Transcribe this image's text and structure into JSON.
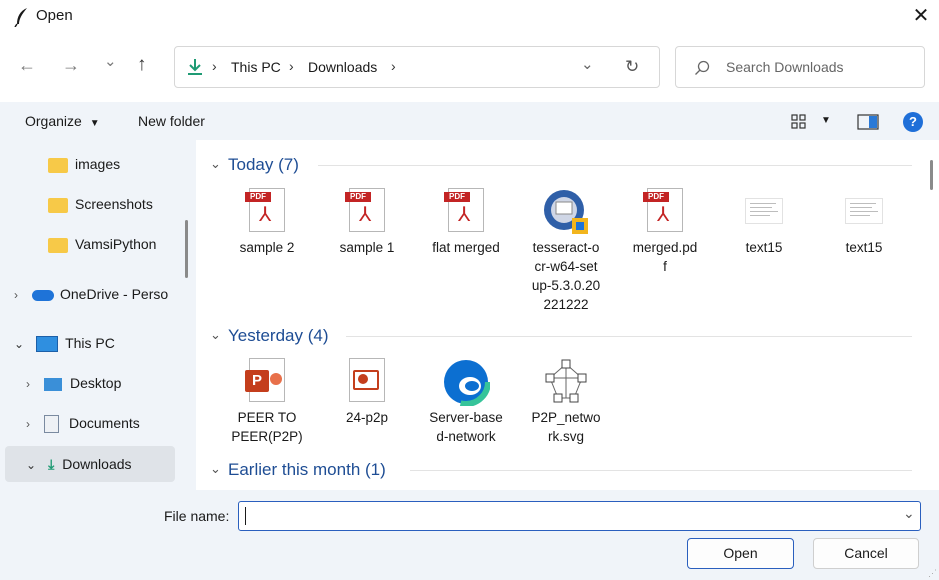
{
  "window": {
    "title": "Open",
    "close_glyph": "✕"
  },
  "nav": {
    "back_glyph": "←",
    "forward_glyph": "→",
    "recent_glyph": "⌄",
    "up_glyph": "↑",
    "breadcrumb": [
      "This PC",
      "Downloads"
    ],
    "refresh_glyph": "↻",
    "dropdown_glyph": "⌄",
    "search_placeholder": "Search Downloads"
  },
  "cmdbar": {
    "organize": "Organize",
    "new_folder": "New folder",
    "help_glyph": "?"
  },
  "sidebar": {
    "items": [
      {
        "label": "images",
        "icon": "folder-icon"
      },
      {
        "label": "Screenshots",
        "icon": "folder-icon"
      },
      {
        "label": "VamsiPython",
        "icon": "folder-icon"
      },
      {
        "label": "OneDrive - Perso",
        "icon": "onedrive-icon"
      },
      {
        "label": "This PC",
        "icon": "pc-icon"
      },
      {
        "label": "Desktop",
        "icon": "desktop-icon"
      },
      {
        "label": "Documents",
        "icon": "documents-icon"
      },
      {
        "label": "Downloads",
        "icon": "downloads-icon",
        "selected": true
      }
    ]
  },
  "groups": [
    {
      "label": "Today (7)"
    },
    {
      "label": "Yesterday (4)"
    },
    {
      "label": "Earlier this month (1)"
    }
  ],
  "today_files": [
    {
      "lines": [
        "sample 2"
      ],
      "icon": "pdf-icon"
    },
    {
      "lines": [
        "sample 1"
      ],
      "icon": "pdf-icon"
    },
    {
      "lines": [
        "flat merged"
      ],
      "icon": "pdf-icon"
    },
    {
      "lines": [
        "tesseract-o",
        "cr-w64-set",
        "up-5.3.0.20",
        "221222"
      ],
      "icon": "installer-icon"
    },
    {
      "lines": [
        "merged.pd",
        "f"
      ],
      "icon": "pdf-icon"
    },
    {
      "lines": [
        "text15"
      ],
      "icon": "text-file-icon"
    },
    {
      "lines": [
        "text15"
      ],
      "icon": "text-file-icon"
    }
  ],
  "yesterday_files": [
    {
      "lines": [
        "PEER TO",
        "PEER(P2P)"
      ],
      "icon": "powerpoint-icon"
    },
    {
      "lines": [
        "24-p2p"
      ],
      "icon": "powerpoint-icon"
    },
    {
      "lines": [
        "Server-base",
        "d-network"
      ],
      "icon": "edge-icon"
    },
    {
      "lines": [
        "P2P_netwo",
        "rk.svg"
      ],
      "icon": "svg-network-icon"
    }
  ],
  "bottom": {
    "file_name_label": "File name:",
    "file_name_value": "",
    "open_label": "Open",
    "cancel_label": "Cancel"
  },
  "colors": {
    "accent": "#2a5fbe",
    "group_heading": "#1e4d94",
    "pane_bg": "#f0f4f9"
  }
}
